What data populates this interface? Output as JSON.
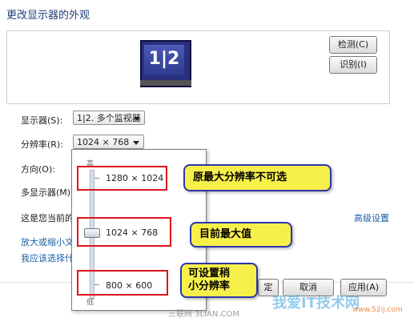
{
  "window": {
    "title": "更改显示器的外观"
  },
  "preview": {
    "monitor_label": "1|2",
    "detect_button": "检测(C)",
    "identify_button": "识别(I)"
  },
  "settings": {
    "display_label": "显示器(S):",
    "display_value": "1|2. 多个监视器",
    "resolution_label": "分辨率(R):",
    "resolution_value": "1024 × 768",
    "orientation_label": "方向(O):",
    "multi_display_label": "多显示器(M):",
    "current_text": "这是您当前的主",
    "advanced_link": "高级设置",
    "link_enlarge": "放大或缩小文本",
    "link_choose": "我应该选择什么"
  },
  "dropdown": {
    "high_label": "高",
    "low_label": "低",
    "options": [
      "1280 × 1024",
      "1024 × 768",
      "800 × 600"
    ],
    "selected_level": 0.5
  },
  "annotations": {
    "max_unavailable": "原最大分辨率不可选",
    "current_max": "目前最大值",
    "can_set_smaller_line1": "可设置稍",
    "can_set_smaller_line2": "小分辨率"
  },
  "buttons": {
    "ok": "定",
    "cancel": "取消",
    "apply": "应用(A)"
  },
  "watermarks": {
    "brand": "我爱IT技术网",
    "url": "www.52ij.com",
    "site": "三联网 3LIAN.COM"
  },
  "colors": {
    "title": "#1e3f79",
    "link": "#1a5fa6",
    "highlight_box": "#e0151c",
    "callout_fill": "#f8f04a",
    "callout_border": "#2a37a8"
  }
}
